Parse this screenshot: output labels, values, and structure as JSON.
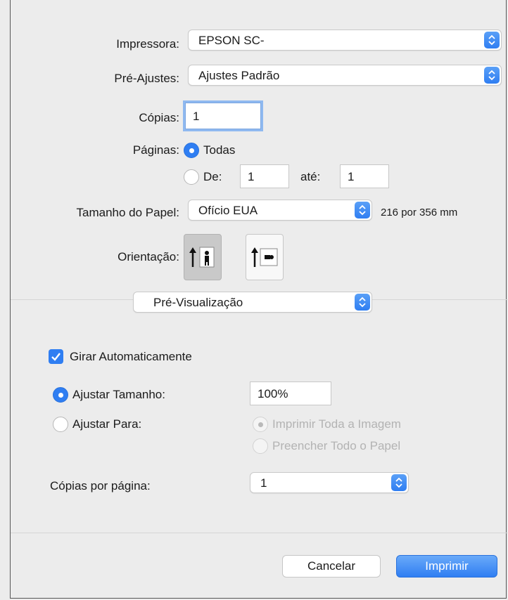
{
  "printer": {
    "label": "Impressora:",
    "value": "EPSON SC-"
  },
  "presets": {
    "label": "Pré-Ajustes:",
    "value": "Ajustes Padrão"
  },
  "copies": {
    "label": "Cópias:",
    "value": "1"
  },
  "pages": {
    "label": "Páginas:",
    "all_label": "Todas",
    "from_label": "De:",
    "from_value": "1",
    "to_label": "até:",
    "to_value": "1",
    "selected": "all"
  },
  "paper_size": {
    "label": "Tamanho do Papel:",
    "value": "Ofício EUA",
    "dimensions": "216 por 356 mm"
  },
  "orientation": {
    "label": "Orientação:",
    "selected": "portrait"
  },
  "section_popup": {
    "value": "Pré-Visualização"
  },
  "auto_rotate": {
    "label": "Girar Automaticamente",
    "checked": true
  },
  "scale": {
    "label": "Ajustar Tamanho:",
    "value": "100%",
    "selected": true
  },
  "scale_to_fit": {
    "label": "Ajustar Para:",
    "selected": false,
    "option_print_entire": "Imprimir Toda a Imagem",
    "option_fill_paper": "Preencher Todo o Papel"
  },
  "copies_per_page": {
    "label": "Cópias por página:",
    "value": "1"
  },
  "buttons": {
    "cancel": "Cancelar",
    "print": "Imprimir"
  },
  "colors": {
    "accent": "#2f7ef2",
    "background": "#ececec"
  },
  "icons": [
    "chevron-updown-icon",
    "portrait-orientation-icon",
    "landscape-orientation-icon",
    "checkmark-icon"
  ]
}
